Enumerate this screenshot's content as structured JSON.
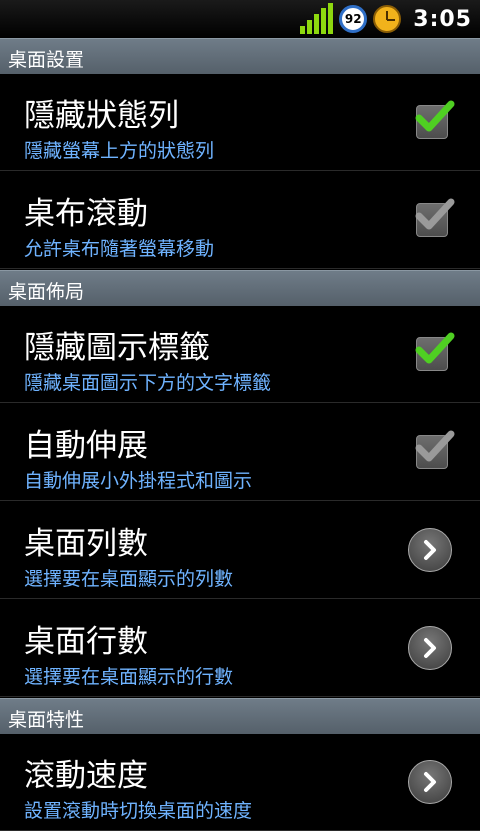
{
  "status_bar": {
    "battery_level": "92",
    "time": "3:05"
  },
  "sections": [
    {
      "label": "桌面設置"
    },
    {
      "label": "桌面佈局"
    },
    {
      "label": "桌面特性"
    }
  ],
  "items": [
    {
      "title": "隱藏狀態列",
      "subtitle": "隱藏螢幕上方的狀態列",
      "control": "checkbox",
      "checked": true,
      "enabled": true
    },
    {
      "title": "桌布滾動",
      "subtitle": "允許桌布隨著螢幕移動",
      "control": "checkbox",
      "checked": true,
      "enabled": false
    },
    {
      "title": "隱藏圖示標籤",
      "subtitle": "隱藏桌面圖示下方的文字標籤",
      "control": "checkbox",
      "checked": true,
      "enabled": true
    },
    {
      "title": "自動伸展",
      "subtitle": "自動伸展小外掛程式和圖示",
      "control": "checkbox",
      "checked": true,
      "enabled": false
    },
    {
      "title": "桌面列數",
      "subtitle": "選擇要在桌面顯示的列數",
      "control": "arrow"
    },
    {
      "title": "桌面行數",
      "subtitle": "選擇要在桌面顯示的行數",
      "control": "arrow"
    },
    {
      "title": "滾動速度",
      "subtitle": "設置滾動時切換桌面的速度",
      "control": "arrow"
    }
  ],
  "colors": {
    "checked_active": "#4fcf22",
    "checked_disabled": "#9a9a9a",
    "subtitle": "#6fb3ff"
  }
}
